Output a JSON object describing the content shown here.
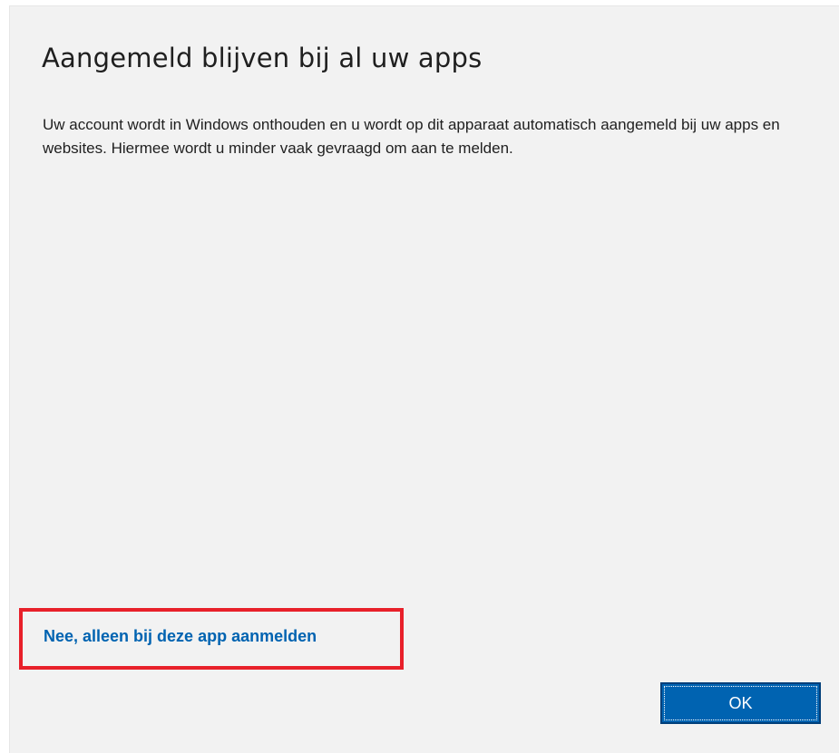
{
  "dialog": {
    "title": "Aangemeld blijven bij al uw apps",
    "description": "Uw account wordt in Windows onthouden en u wordt op dit apparaat automatisch aangemeld bij uw apps en websites. Hiermee wordt u minder vaak gevraagd om aan te melden.",
    "local_signin_link": "Nee, alleen bij deze app aanmelden",
    "ok_label": "OK"
  },
  "colors": {
    "background": "#f2f2f2",
    "link": "#0063b1",
    "button": "#0063b1",
    "highlight": "#e8202a"
  }
}
